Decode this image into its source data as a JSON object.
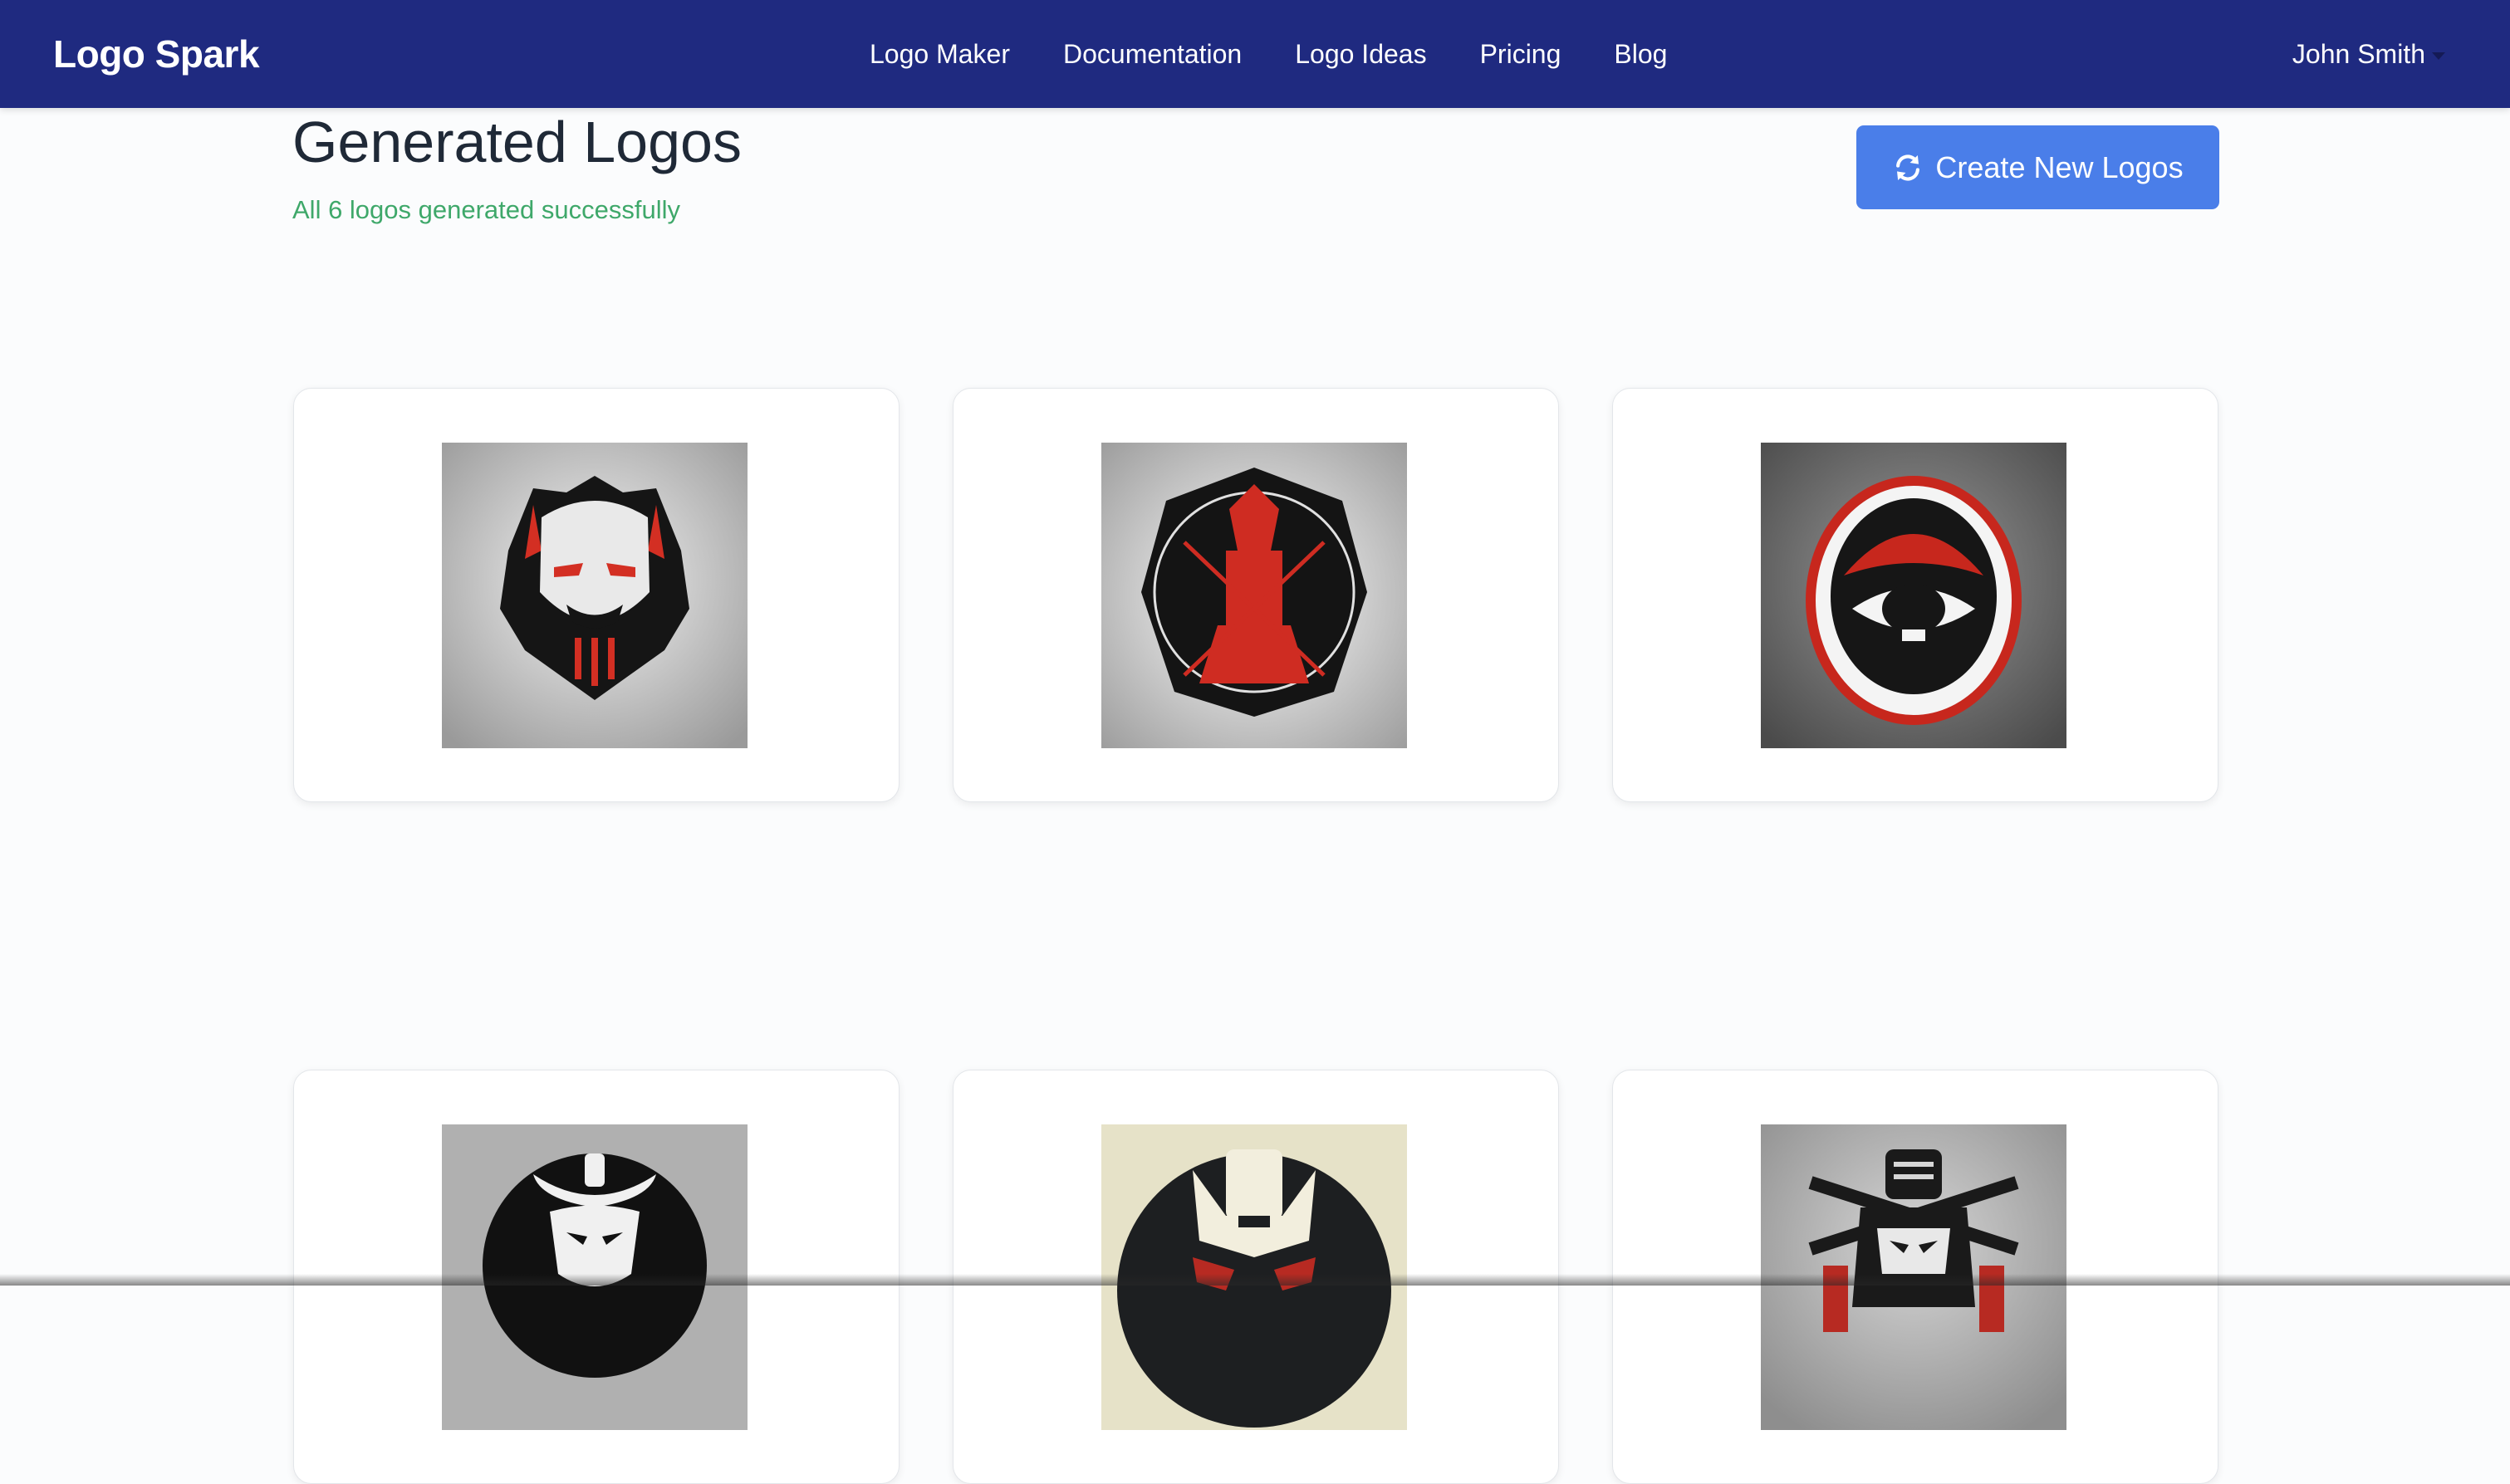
{
  "navbar": {
    "brand": "Logo Spark",
    "links": [
      "Logo Maker",
      "Documentation",
      "Logo Ideas",
      "Pricing",
      "Blog"
    ],
    "user": "John Smith"
  },
  "main": {
    "title": "Generated Logos",
    "status": "All 6 logos generated successfully",
    "create_button": "Create New Logos"
  },
  "logos": [
    {
      "icon": "samurai-mask-logo",
      "background": "#b9b9b9"
    },
    {
      "icon": "samurai-warrior-badge-logo",
      "background": "#bdbdbd"
    },
    {
      "icon": "samurai-helmet-emblem-logo",
      "background": "#6f6f6f"
    },
    {
      "icon": "samurai-circle-logo",
      "background": "#b0b0b0"
    },
    {
      "icon": "samurai-oni-mask-logo",
      "background": "#e6e2c8"
    },
    {
      "icon": "samurai-armor-logo",
      "background": "#a8a8a8"
    }
  ],
  "colors": {
    "navbar": "#1f2a80",
    "button": "#4a7ee9",
    "success": "#3fa86a"
  }
}
